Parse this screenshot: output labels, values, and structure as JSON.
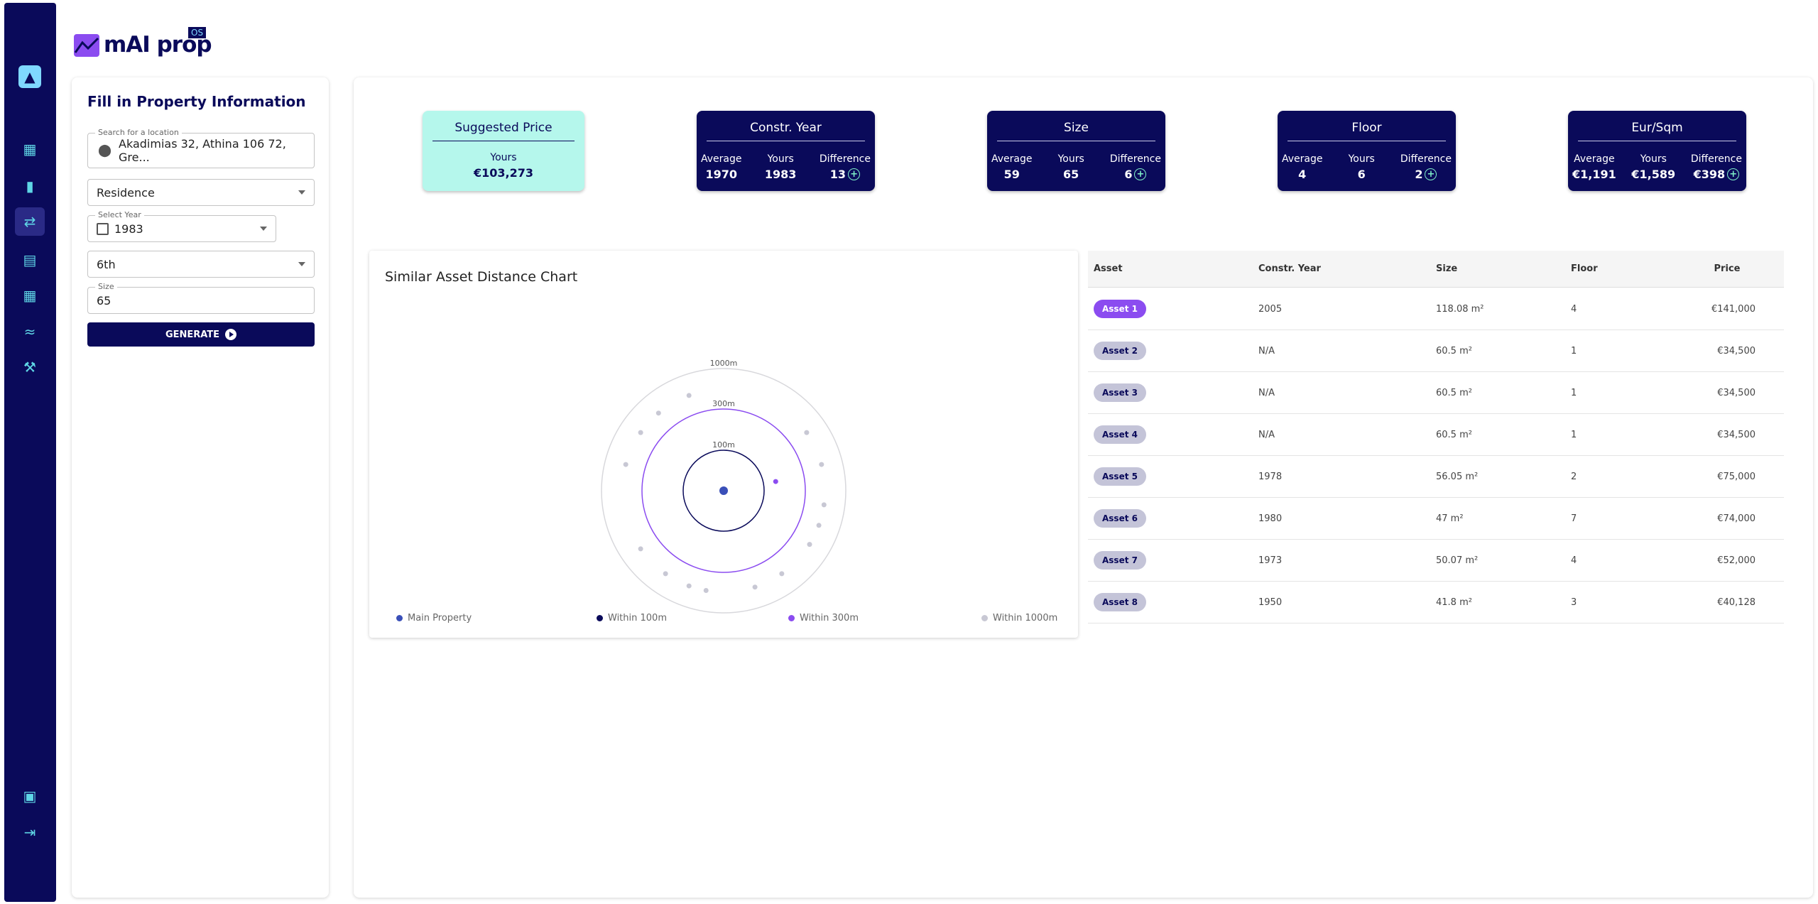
{
  "brand": {
    "name": "mAI prop",
    "badge": "OS"
  },
  "sidebar": {
    "items": [
      {
        "name": "logo-icon",
        "glyph": "▲"
      },
      {
        "name": "map-icon",
        "glyph": "▦"
      },
      {
        "name": "bar-chart-icon",
        "glyph": "▮"
      },
      {
        "name": "compare-icon",
        "glyph": "⇄"
      },
      {
        "name": "document-icon",
        "glyph": "▤"
      },
      {
        "name": "table-icon",
        "glyph": "▦"
      },
      {
        "name": "trend-icon",
        "glyph": "≈"
      },
      {
        "name": "auction-icon",
        "glyph": "⚒"
      },
      {
        "name": "dashboard-icon",
        "glyph": "▣"
      },
      {
        "name": "logout-icon",
        "glyph": "⇥"
      }
    ]
  },
  "form": {
    "title": "Fill in Property Information",
    "location_label": "Search for a location",
    "location_value": "Akadimias 32, Athina 106 72, Gre...",
    "type_value": "Residence",
    "year_label": "Select Year",
    "year_value": "1983",
    "floor_value": "6th",
    "size_label": "Size",
    "size_value": "65",
    "generate_label": "GENERATE"
  },
  "cards": {
    "suggested": {
      "title": "Suggested Price",
      "yours_label": "Yours",
      "value": "€103,273"
    },
    "constr": {
      "title": "Constr. Year",
      "avg_label": "Average",
      "avg": "1970",
      "yours_label": "Yours",
      "yours": "1983",
      "diff_label": "Difference",
      "diff": "13"
    },
    "size": {
      "title": "Size",
      "avg_label": "Average",
      "avg": "59",
      "yours_label": "Yours",
      "yours": "65",
      "diff_label": "Difference",
      "diff": "6"
    },
    "floor": {
      "title": "Floor",
      "avg_label": "Average",
      "avg": "4",
      "yours_label": "Yours",
      "yours": "6",
      "diff_label": "Difference",
      "diff": "2"
    },
    "eursqm": {
      "title": "Eur/Sqm",
      "avg_label": "Average",
      "avg": "€1,191",
      "yours_label": "Yours",
      "yours": "€1,589",
      "diff_label": "Difference",
      "diff": "€398"
    }
  },
  "chart": {
    "title": "Similar Asset Distance Chart",
    "ring_labels": [
      "100m",
      "300m",
      "1000m"
    ],
    "legend": [
      "Main Property",
      "Within 100m",
      "Within 300m",
      "Within 1000m"
    ],
    "colors": {
      "main": "#3a4fb8",
      "within100": "#0a0a5a",
      "within300": "#8b4cf0",
      "within1000": "#c8c8d4"
    }
  },
  "chart_data": {
    "type": "scatter",
    "title": "Similar Asset Distance Chart",
    "rings_m": [
      100,
      300,
      1000
    ],
    "series": [
      {
        "name": "Main Property",
        "points": [
          {
            "distance_m": 0,
            "angle_deg": 0
          }
        ]
      },
      {
        "name": "Within 300m",
        "points": [
          {
            "distance_m": 160,
            "angle_deg": 80
          }
        ]
      },
      {
        "name": "Within 1000m",
        "points": [
          {
            "distance_m": 640,
            "angle_deg": -40
          },
          {
            "distance_m": 640,
            "angle_deg": -55
          },
          {
            "distance_m": 640,
            "angle_deg": 55
          },
          {
            "distance_m": 640,
            "angle_deg": 75
          },
          {
            "distance_m": 640,
            "angle_deg": 98
          },
          {
            "distance_m": 640,
            "angle_deg": 122
          },
          {
            "distance_m": 640,
            "angle_deg": 145
          },
          {
            "distance_m": 640,
            "angle_deg": 162
          },
          {
            "distance_m": 640,
            "angle_deg": 190
          },
          {
            "distance_m": 640,
            "angle_deg": 215
          },
          {
            "distance_m": 640,
            "angle_deg": 235
          },
          {
            "distance_m": 640,
            "angle_deg": -75
          },
          {
            "distance_m": 640,
            "angle_deg": 200
          },
          {
            "distance_m": 640,
            "angle_deg": 110
          },
          {
            "distance_m": 640,
            "angle_deg": -20
          }
        ]
      }
    ]
  },
  "table": {
    "headers": [
      "Asset",
      "Constr. Year",
      "Size",
      "Floor",
      "Price"
    ],
    "rows": [
      {
        "asset": "Asset 1",
        "year": "2005",
        "size": "118.08 m²",
        "floor": "4",
        "price": "€141,000"
      },
      {
        "asset": "Asset 2",
        "year": "N/A",
        "size": "60.5 m²",
        "floor": "1",
        "price": "€34,500"
      },
      {
        "asset": "Asset 3",
        "year": "N/A",
        "size": "60.5 m²",
        "floor": "1",
        "price": "€34,500"
      },
      {
        "asset": "Asset 4",
        "year": "N/A",
        "size": "60.5 m²",
        "floor": "1",
        "price": "€34,500"
      },
      {
        "asset": "Asset 5",
        "year": "1978",
        "size": "56.05 m²",
        "floor": "2",
        "price": "€75,000"
      },
      {
        "asset": "Asset 6",
        "year": "1980",
        "size": "47 m²",
        "floor": "7",
        "price": "€74,000"
      },
      {
        "asset": "Asset 7",
        "year": "1973",
        "size": "50.07 m²",
        "floor": "4",
        "price": "€52,000"
      },
      {
        "asset": "Asset 8",
        "year": "1950",
        "size": "41.8 m²",
        "floor": "3",
        "price": "€40,128"
      }
    ]
  }
}
